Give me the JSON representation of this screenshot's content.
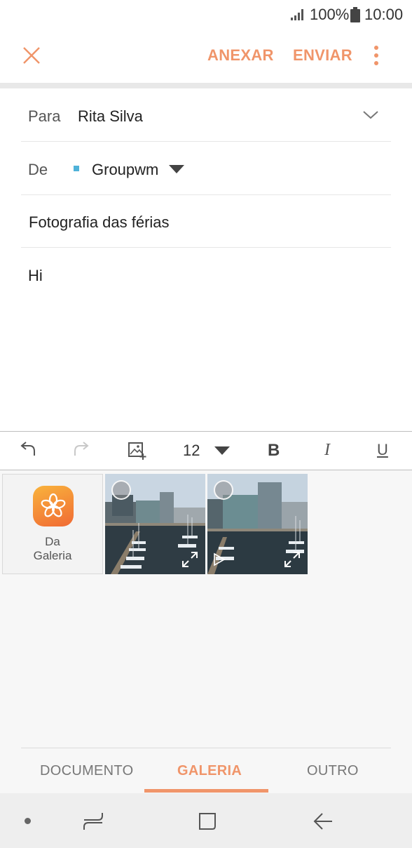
{
  "status_bar": {
    "battery": "100%",
    "time": "10:00",
    "icons": [
      "signal-icon",
      "battery-icon"
    ]
  },
  "app_bar": {
    "close_icon": "close-icon",
    "attach_label": "ANEXAR",
    "send_label": "ENVIAR",
    "more_icon": "more-vert-icon"
  },
  "compose": {
    "to_label": "Para",
    "to_value": "Rita Silva",
    "from_label": "De",
    "from_value": "Groupwm",
    "subject": "Fotografia das férias",
    "body": "Hi"
  },
  "format_toolbar": {
    "font_size": "12",
    "bold_label": "B",
    "italic_label": "I",
    "underline_label": "U"
  },
  "attachments": {
    "gallery_tile_label_line1": "Da",
    "gallery_tile_label_line2": "Galeria"
  },
  "tabs": [
    {
      "label": "DOCUMENTO",
      "active": false
    },
    {
      "label": "GALERIA",
      "active": true
    },
    {
      "label": "OUTRO",
      "active": false
    }
  ],
  "colors": {
    "accent": "#f0956a",
    "account_dot": "#4fb2d9"
  }
}
